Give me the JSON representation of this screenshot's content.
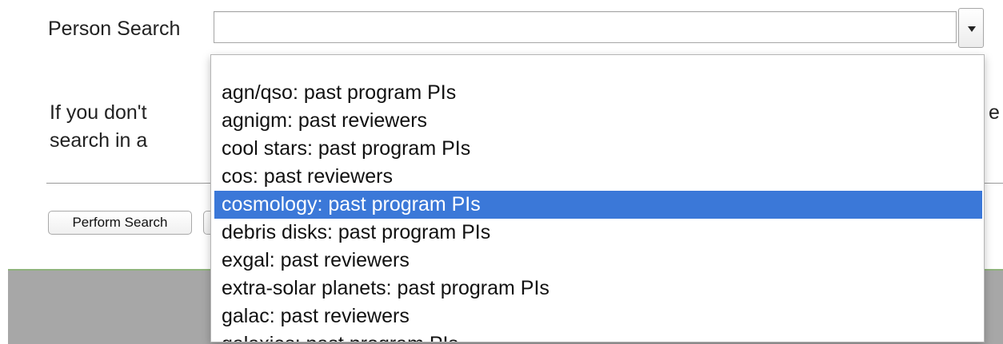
{
  "form": {
    "person_search_label": "Person Search",
    "select_value": "",
    "help_line_1": "If you don't",
    "help_line_2": "search in a",
    "help_line_1_tail": "e",
    "perform_search_label": "Perform Search",
    "second_button_label": ""
  },
  "dropdown": {
    "options": [
      "",
      "agn/qso: past program PIs",
      "agnigm: past reviewers",
      "cool stars: past program PIs",
      "cos: past reviewers",
      "cosmology: past program PIs",
      "debris disks: past program PIs",
      "exgal: past reviewers",
      "extra-solar planets: past program PIs",
      "galac: past reviewers",
      "galaxies: past program PIs"
    ],
    "selected": "cosmology: past program PIs"
  },
  "colors": {
    "selection": "#3b78d8",
    "footer": "#a7a7a7"
  }
}
